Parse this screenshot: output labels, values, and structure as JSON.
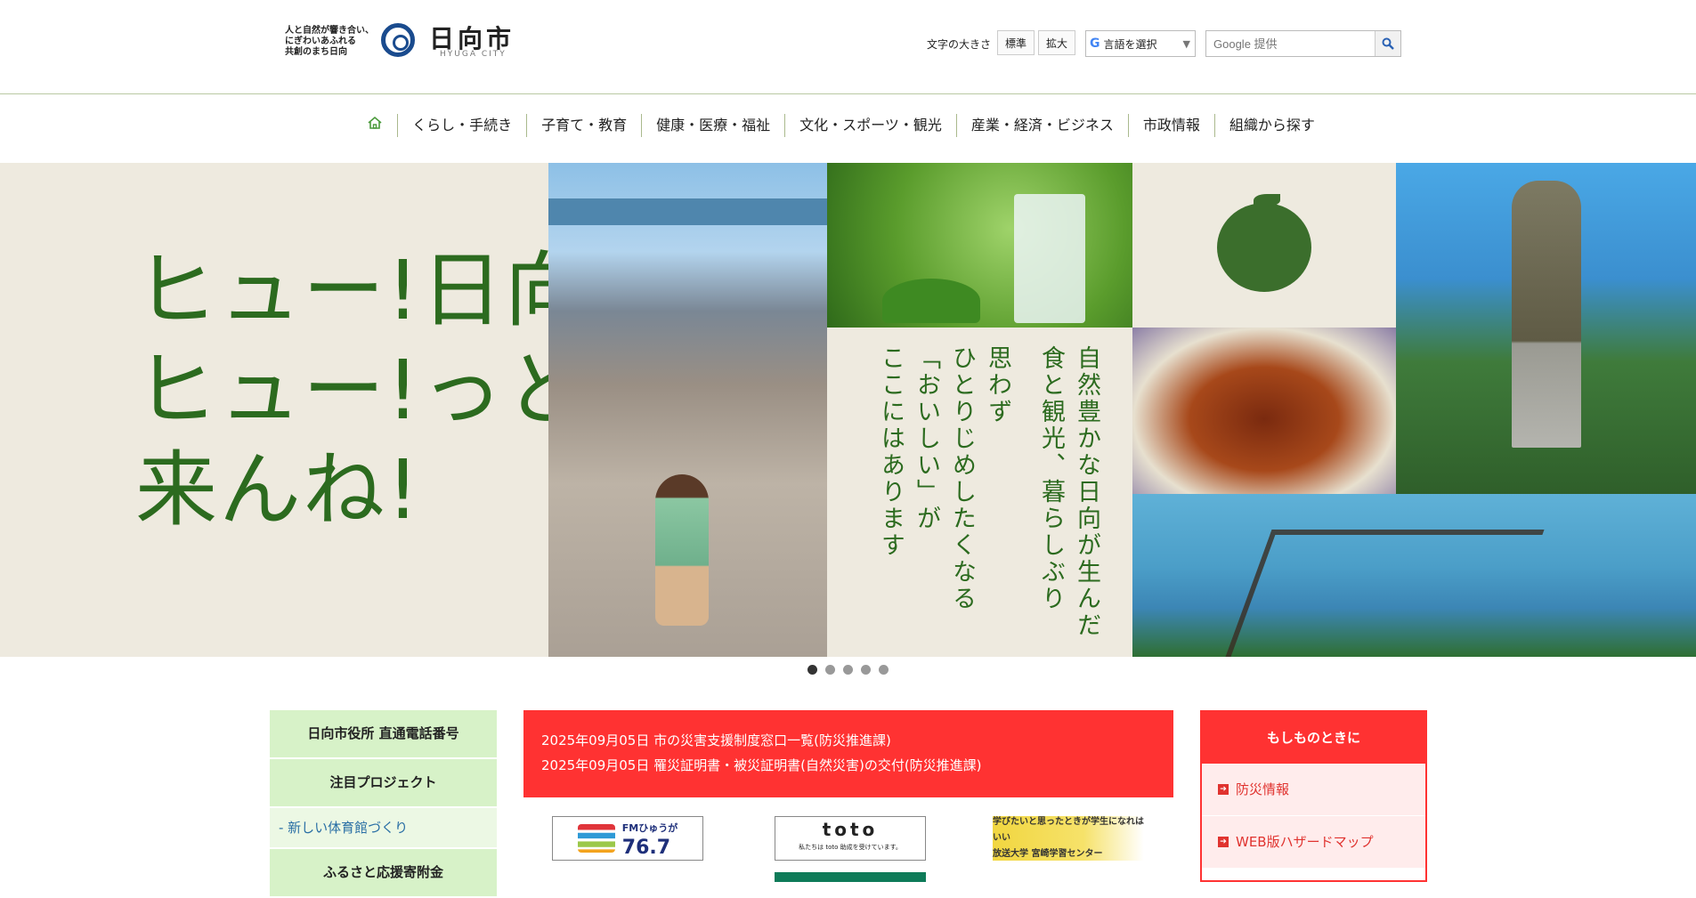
{
  "header": {
    "tagline": "人と自然が響き合い、\nにぎわいあふれる\n共創のまち日向",
    "logo_jp": "日向市",
    "logo_en": "HYUGA CITY",
    "font_size_label": "文字の大きさ",
    "font_size_normal": "標準",
    "font_size_large": "拡大",
    "language_select": "言語を選択",
    "search_placeholder": "Google 提供"
  },
  "nav": {
    "home_icon": "home-icon",
    "items": [
      "くらし・手続き",
      "子育て・教育",
      "健康・医療・福祉",
      "文化・スポーツ・観光",
      "産業・経済・ビジネス",
      "市政情報",
      "組織から探す"
    ]
  },
  "hero": {
    "slogan": "ヒュー!日向\nヒュー!っと\n来んね!",
    "vertical_text": [
      "自然豊かな日向が生んだ",
      "食と観光、暮らしぶり",
      "思わず",
      "ひとりじめしたくなる",
      "「おいしい」が",
      "ここにはあります"
    ],
    "slide_count": 5,
    "active_slide": 1
  },
  "left_menu": {
    "items": [
      "日向市役所 直通電話番号",
      "注目プロジェクト",
      "- 新しい体育館づくり",
      "ふるさと応援寄附金"
    ]
  },
  "news": {
    "items": [
      "2025年09月05日 市の災害支援制度窓口一覧(防災推進課)",
      "2025年09月05日 罹災証明書・被災証明書(自然災害)の交付(防災推進課)"
    ]
  },
  "banners": {
    "fm_label": "FMひゅうが",
    "fm_freq": "76.7",
    "toto": "toto",
    "toto_sub": "私たちは toto 助成を受けています。",
    "univ_line1": "学びたいと思ったときが学生になれはいい",
    "univ_line2": "放送大学 宮崎学習センター"
  },
  "emergency": {
    "title": "もしものときに",
    "items": [
      "防災情報",
      "WEB版ハザードマップ"
    ]
  },
  "colors": {
    "green_text": "#2c6b1f",
    "news_red": "#ff3232",
    "menu_green": "#d7f2c8"
  }
}
